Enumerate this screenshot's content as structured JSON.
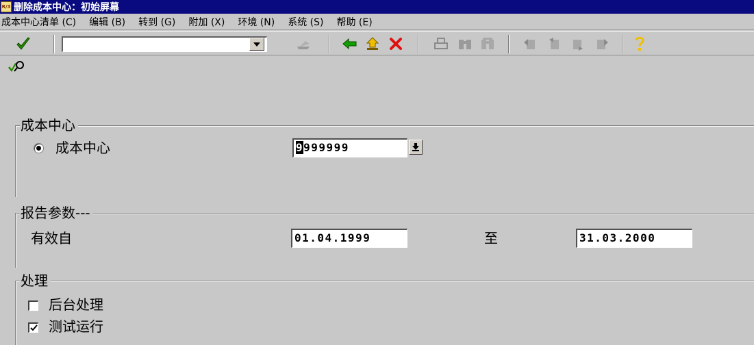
{
  "window": {
    "logo_text": "R/3",
    "title": "删除成本中心：初始屏幕"
  },
  "menu": [
    "成本中心清单 (C)",
    "编辑 (B)",
    "转到 (G)",
    "附加 (X)",
    "环境 (N)",
    "系统 (S)",
    "帮助 (E)"
  ],
  "toolbar": {
    "command_field_value": ""
  },
  "groups": {
    "cost_center": {
      "title": "成本中心",
      "radio_label": "成本中心",
      "radio_selected": true,
      "value_first_char": "9",
      "value_rest": "999999"
    },
    "report_params": {
      "title": "报告参数---",
      "valid_from_label": "有效自",
      "valid_from_value": "01.04.1999",
      "to_label": "至",
      "valid_to_value": "31.03.2000"
    },
    "processing": {
      "title": "处理",
      "background_label": "后台处理",
      "background_checked": false,
      "test_run_label": "测试运行",
      "test_run_checked": true
    }
  },
  "colors": {
    "title_bar": "#0a0a80",
    "background": "#c8c8c8",
    "check_green": "#2a8a00",
    "back_green": "#10a000",
    "cancel_red": "#e01010"
  }
}
